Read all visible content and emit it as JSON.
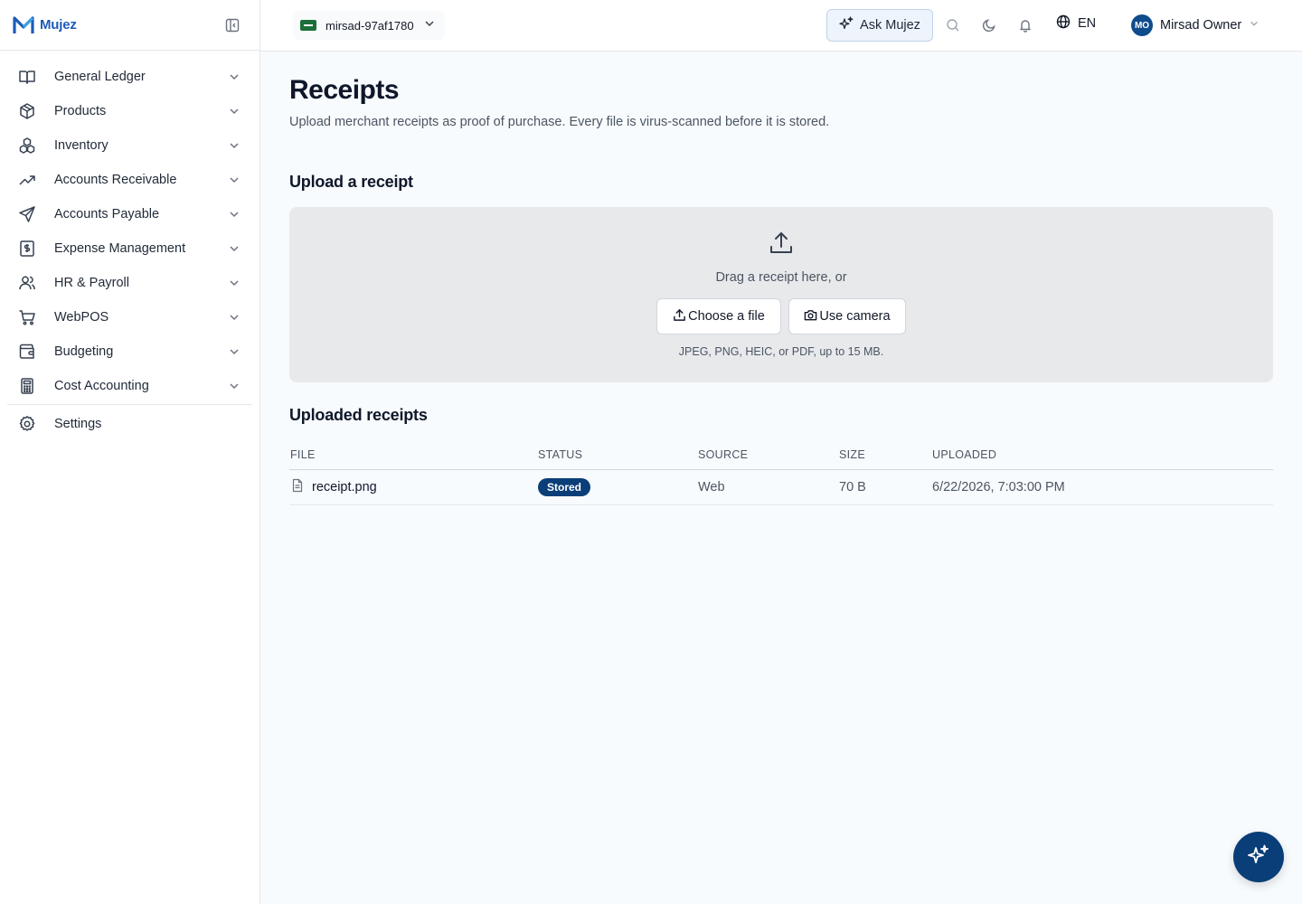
{
  "brand": {
    "name": "Mujez"
  },
  "sidebar": {
    "items": [
      {
        "label": "General Ledger",
        "icon": "book-open-icon"
      },
      {
        "label": "Products",
        "icon": "package-icon"
      },
      {
        "label": "Inventory",
        "icon": "boxes-icon"
      },
      {
        "label": "Accounts Receivable",
        "icon": "trending-up-icon"
      },
      {
        "label": "Accounts Payable",
        "icon": "send-icon"
      },
      {
        "label": "Expense Management",
        "icon": "receipt-dollar-icon"
      },
      {
        "label": "HR & Payroll",
        "icon": "users-icon"
      },
      {
        "label": "WebPOS",
        "icon": "cart-icon"
      },
      {
        "label": "Budgeting",
        "icon": "wallet-icon"
      },
      {
        "label": "Cost Accounting",
        "icon": "calculator-icon"
      }
    ],
    "settings": {
      "label": "Settings",
      "icon": "gear-icon"
    }
  },
  "topbar": {
    "org": "mirsad-97af1780",
    "ask": "Ask Mujez",
    "language": "EN",
    "user": {
      "initials": "MO",
      "name": "Mirsad Owner"
    }
  },
  "page": {
    "title": "Receipts",
    "description": "Upload merchant receipts as proof of purchase. Every file is virus-scanned before it is stored."
  },
  "upload": {
    "heading": "Upload a receipt",
    "drag_text": "Drag a receipt here, or",
    "choose_label": "Choose a file",
    "camera_label": "Use camera",
    "hint": "JPEG, PNG, HEIC, or PDF, up to 15 MB."
  },
  "uploaded": {
    "heading": "Uploaded receipts",
    "columns": [
      "FILE",
      "STATUS",
      "SOURCE",
      "SIZE",
      "UPLOADED"
    ],
    "rows": [
      {
        "file": "receipt.png",
        "status": "Stored",
        "source": "Web",
        "size": "70 B",
        "uploaded": "6/22/2026, 7:03:00 PM"
      }
    ]
  },
  "colors": {
    "primary": "#0a3e78",
    "brand": "#1e5bb8"
  }
}
